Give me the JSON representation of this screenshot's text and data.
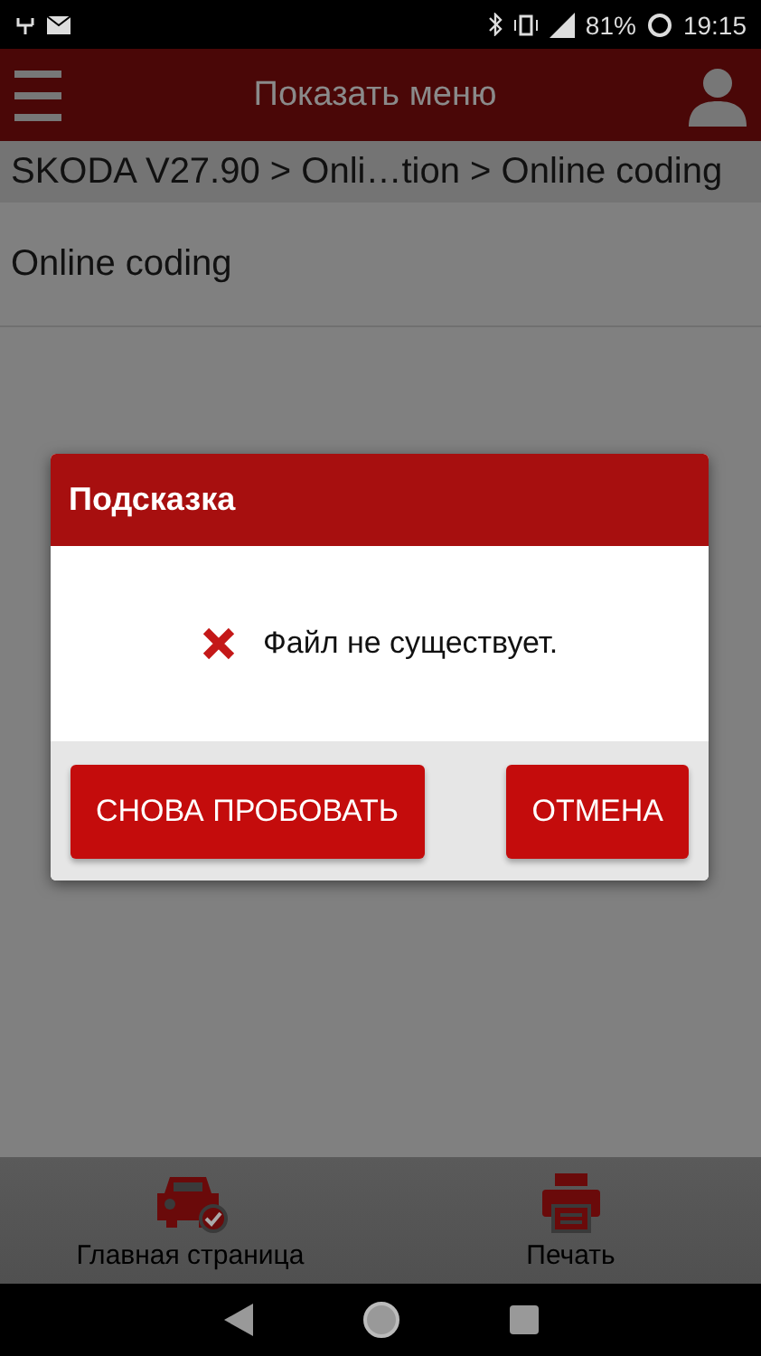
{
  "status_bar": {
    "battery": "81%",
    "time": "19:15"
  },
  "header": {
    "title": "Показать меню"
  },
  "breadcrumb": "SKODA V27.90 > Onli…tion > Online coding",
  "list": [
    {
      "label": "Online coding"
    }
  ],
  "dialog": {
    "title": "Подсказка",
    "message": "Файл не существует.",
    "buttons": [
      "СНОВА ПРОБОВАТЬ",
      "ОТМЕНА"
    ]
  },
  "bottom_nav": [
    {
      "label": "Главная страница",
      "kind": "car"
    },
    {
      "label": "Печать",
      "kind": "print"
    }
  ]
}
